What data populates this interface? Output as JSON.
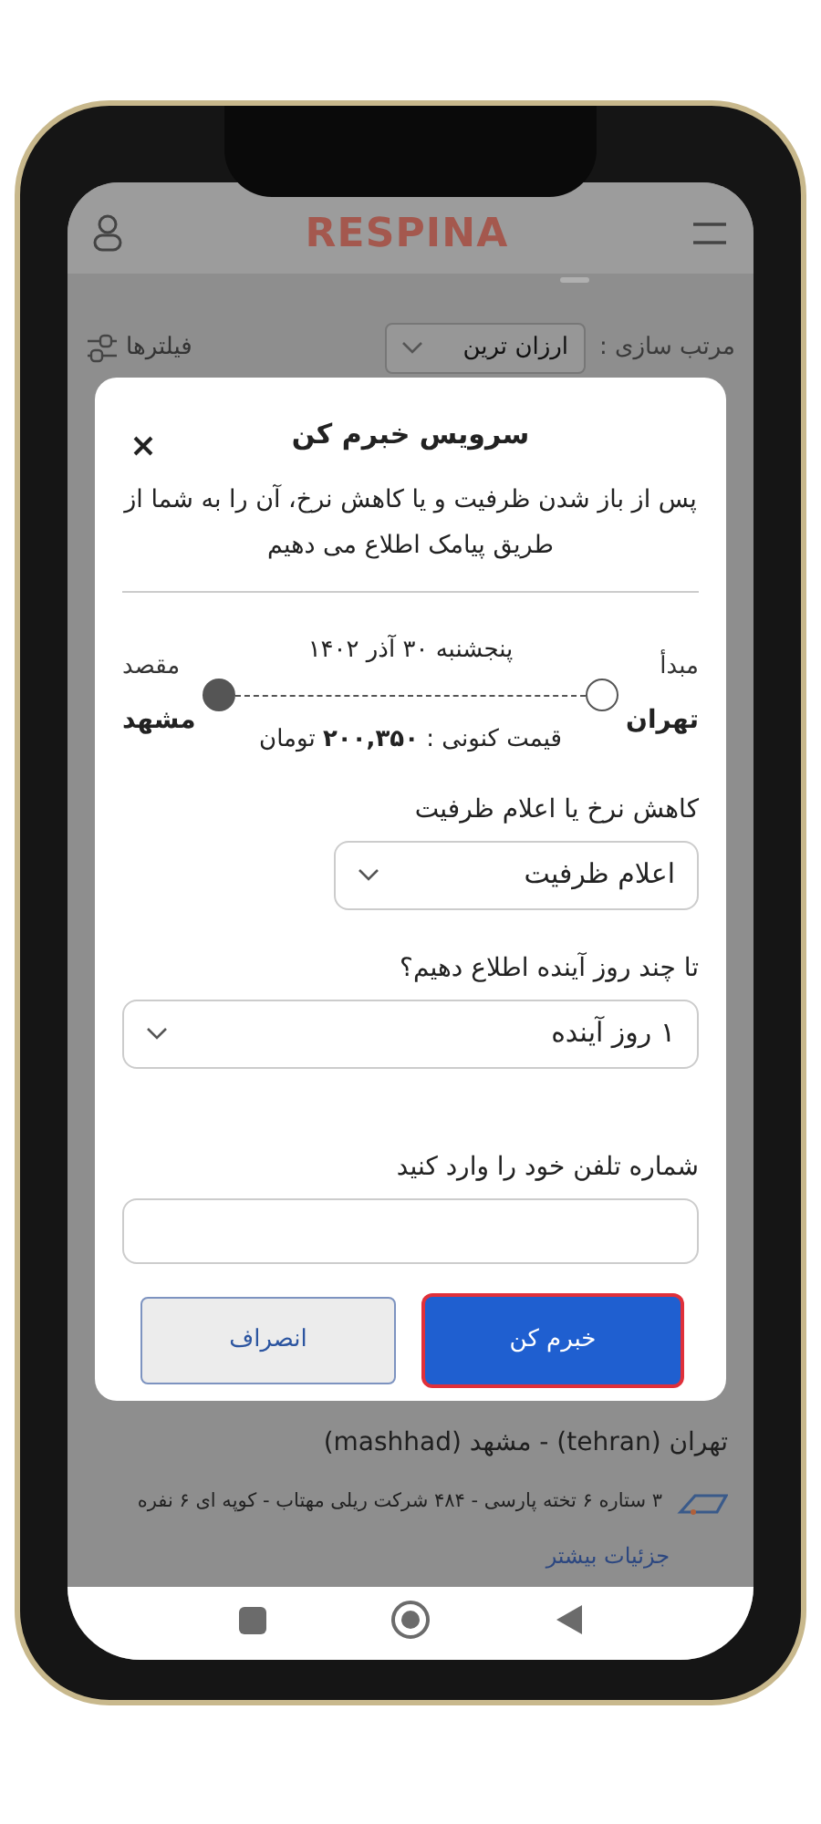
{
  "header": {
    "logo": "RESPINA"
  },
  "sort": {
    "label": "مرتب سازی :",
    "value": "ارزان ترین"
  },
  "filters": {
    "label": "فیلترها"
  },
  "dialog": {
    "title": "سرویس خبرم کن",
    "description": "پس از باز شدن ظرفیت و یا کاهش نرخ، آن را به شما از طریق پیامک اطلاع می دهیم",
    "trip": {
      "origin_label": "مبدأ",
      "origin": "تهران",
      "destination_label": "مقصد",
      "destination": "مشهد",
      "date": "پنجشنبه ۳۰ آذر ۱۴۰۲",
      "price_label": "قیمت کنونی :",
      "price": "۲۰۰,۳۵۰",
      "currency": "تومان"
    },
    "fields": [
      {
        "kind": "select",
        "label": "کاهش نرخ یا اعلام ظرفیت",
        "value": "اعلام ظرفیت"
      },
      {
        "kind": "select",
        "label": "تا چند روز آینده اطلاع دهیم؟",
        "value": "۱ روز آینده"
      },
      {
        "kind": "input",
        "label": "شماره تلفن خود را وارد کنید"
      }
    ],
    "buttons": [
      {
        "label": "خبرم کن",
        "kind": "primary",
        "focused": true
      },
      {
        "label": "انصراف",
        "kind": "secondary",
        "focused": false
      }
    ]
  },
  "route": "تهران (tehran) - مشهد (mashhad)",
  "company": "۳ ستاره ۶ تخته پارسی - ۴۸۴  شرکت ریلی مهتاب - کوپه ای ۶ نفره",
  "details_link": "جزئیات بیشتر"
}
